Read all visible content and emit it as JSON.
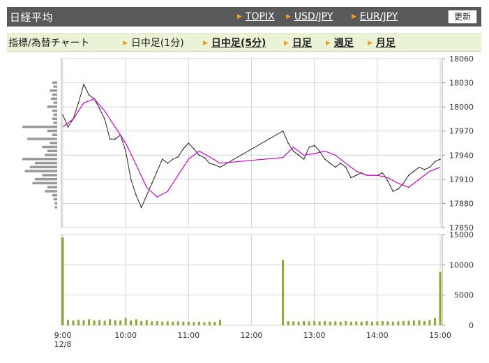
{
  "header": {
    "title": "日経平均",
    "links": [
      "TOPIX",
      "USD/JPY",
      "EUR/JPY"
    ],
    "refresh_label": "更新"
  },
  "subnav": {
    "title": "指標/為替チャート",
    "items": [
      {
        "label": "日中足(1分)",
        "active": false
      },
      {
        "label": "日中足(5分)",
        "active": true
      },
      {
        "label": "日足",
        "active": false
      },
      {
        "label": "週足",
        "active": false
      },
      {
        "label": "月足",
        "active": false
      }
    ]
  },
  "colors": {
    "price_line": "#222222",
    "moving_average": "#cc00cc",
    "volume_bar": "#8aa832",
    "profile_bar": "#999999",
    "grid": "#d6d6d6"
  },
  "chart_data": [
    {
      "type": "line",
      "title": "",
      "xlabel": "",
      "ylabel": "",
      "x_ticks": [
        "9:00",
        "10:00",
        "11:00",
        "12:00",
        "13:00",
        "14:00",
        "15:00"
      ],
      "x_date_label": "12/8",
      "y_ticks": [
        17850,
        17880,
        17910,
        17940,
        17970,
        18000,
        18030,
        18060
      ],
      "ylim": [
        17850,
        18060
      ],
      "grid": true,
      "series": [
        {
          "role": "price",
          "x": [
            "9:00",
            "9:05",
            "9:10",
            "9:15",
            "9:20",
            "9:25",
            "9:30",
            "9:35",
            "9:40",
            "9:45",
            "9:50",
            "9:55",
            "10:00",
            "10:05",
            "10:10",
            "10:15",
            "10:20",
            "10:25",
            "10:30",
            "10:35",
            "10:40",
            "10:45",
            "10:50",
            "10:55",
            "11:00",
            "11:05",
            "11:10",
            "11:15",
            "11:20",
            "11:25",
            "11:30",
            "12:30",
            "12:35",
            "12:40",
            "12:45",
            "12:50",
            "12:55",
            "13:00",
            "13:05",
            "13:10",
            "13:15",
            "13:20",
            "13:25",
            "13:30",
            "13:35",
            "13:40",
            "13:45",
            "13:50",
            "13:55",
            "14:00",
            "14:05",
            "14:10",
            "14:15",
            "14:20",
            "14:25",
            "14:30",
            "14:35",
            "14:40",
            "14:45",
            "14:50",
            "14:55",
            "15:00"
          ],
          "values": [
            17990,
            17975,
            17985,
            18005,
            18028,
            18015,
            18010,
            17998,
            17985,
            17960,
            17960,
            17965,
            17945,
            17910,
            17890,
            17875,
            17890,
            17905,
            17920,
            17935,
            17930,
            17935,
            17938,
            17948,
            17955,
            17948,
            17940,
            17937,
            17930,
            17928,
            17925,
            17970,
            17955,
            17945,
            17940,
            17935,
            17950,
            17952,
            17945,
            17935,
            17930,
            17925,
            17930,
            17925,
            17912,
            17915,
            17918,
            17915,
            17915,
            17915,
            17918,
            17908,
            17895,
            17898,
            17905,
            17915,
            17920,
            17925,
            17922,
            17925,
            17932,
            17935
          ]
        },
        {
          "role": "moving_average",
          "x": [
            "9:00",
            "9:10",
            "9:20",
            "9:30",
            "9:40",
            "9:50",
            "10:00",
            "10:10",
            "10:20",
            "10:30",
            "10:40",
            "10:50",
            "11:00",
            "11:10",
            "11:20",
            "11:30",
            "12:30",
            "12:40",
            "12:50",
            "13:00",
            "13:10",
            "13:20",
            "13:30",
            "13:40",
            "13:50",
            "14:00",
            "14:10",
            "14:20",
            "14:30",
            "14:40",
            "14:50",
            "15:00"
          ],
          "values": [
            17975,
            17985,
            18005,
            18010,
            17995,
            17975,
            17955,
            17928,
            17900,
            17888,
            17895,
            17915,
            17935,
            17945,
            17938,
            17930,
            17937,
            17950,
            17940,
            17942,
            17945,
            17940,
            17930,
            17920,
            17915,
            17915,
            17912,
            17905,
            17900,
            17910,
            17920,
            17925
          ]
        }
      ]
    },
    {
      "type": "bar",
      "title": "",
      "xlabel": "",
      "ylabel": "",
      "y_ticks": [
        0,
        5000,
        10000,
        15000
      ],
      "ylim": [
        0,
        15000
      ],
      "x": [
        "9:00",
        "9:05",
        "9:10",
        "9:15",
        "9:20",
        "9:25",
        "9:30",
        "9:35",
        "9:40",
        "9:45",
        "9:50",
        "9:55",
        "10:00",
        "10:05",
        "10:10",
        "10:15",
        "10:20",
        "10:25",
        "10:30",
        "10:35",
        "10:40",
        "10:45",
        "10:50",
        "10:55",
        "11:00",
        "11:05",
        "11:10",
        "11:15",
        "11:20",
        "11:25",
        "11:30",
        "12:30",
        "12:35",
        "12:40",
        "12:45",
        "12:50",
        "12:55",
        "13:00",
        "13:05",
        "13:10",
        "13:15",
        "13:20",
        "13:25",
        "13:30",
        "13:35",
        "13:40",
        "13:45",
        "13:50",
        "13:55",
        "14:00",
        "14:05",
        "14:10",
        "14:15",
        "14:20",
        "14:25",
        "14:30",
        "14:35",
        "14:40",
        "14:45",
        "14:50",
        "14:55",
        "15:00"
      ],
      "values": [
        14500,
        900,
        800,
        900,
        850,
        1000,
        800,
        900,
        750,
        1000,
        850,
        800,
        1200,
        800,
        1000,
        700,
        900,
        650,
        700,
        600,
        650,
        600,
        650,
        600,
        600,
        550,
        600,
        550,
        600,
        550,
        900,
        10800,
        700,
        650,
        600,
        700,
        650,
        700,
        650,
        700,
        600,
        650,
        600,
        700,
        600,
        650,
        600,
        700,
        600,
        650,
        700,
        650,
        600,
        650,
        700,
        750,
        800,
        850,
        700,
        900,
        1200,
        8800
      ]
    },
    {
      "type": "bar",
      "role": "price_volume_profile",
      "orientation": "horizontal",
      "price_levels": [
        18030,
        18025,
        18020,
        18015,
        18010,
        18005,
        18000,
        17995,
        17990,
        17985,
        17980,
        17975,
        17970,
        17965,
        17960,
        17955,
        17950,
        17945,
        17940,
        17935,
        17930,
        17925,
        17920,
        17915,
        17910,
        17905,
        17900,
        17895,
        17890,
        17885,
        17880,
        17875
      ],
      "values": [
        2,
        1.5,
        3,
        2,
        2.5,
        1.5,
        4,
        2,
        1.5,
        2,
        1.5,
        14,
        4,
        2,
        12,
        3,
        6,
        4,
        5,
        14,
        9,
        11,
        13,
        6,
        9,
        10,
        4,
        5,
        2,
        1.5,
        1,
        1
      ]
    }
  ]
}
